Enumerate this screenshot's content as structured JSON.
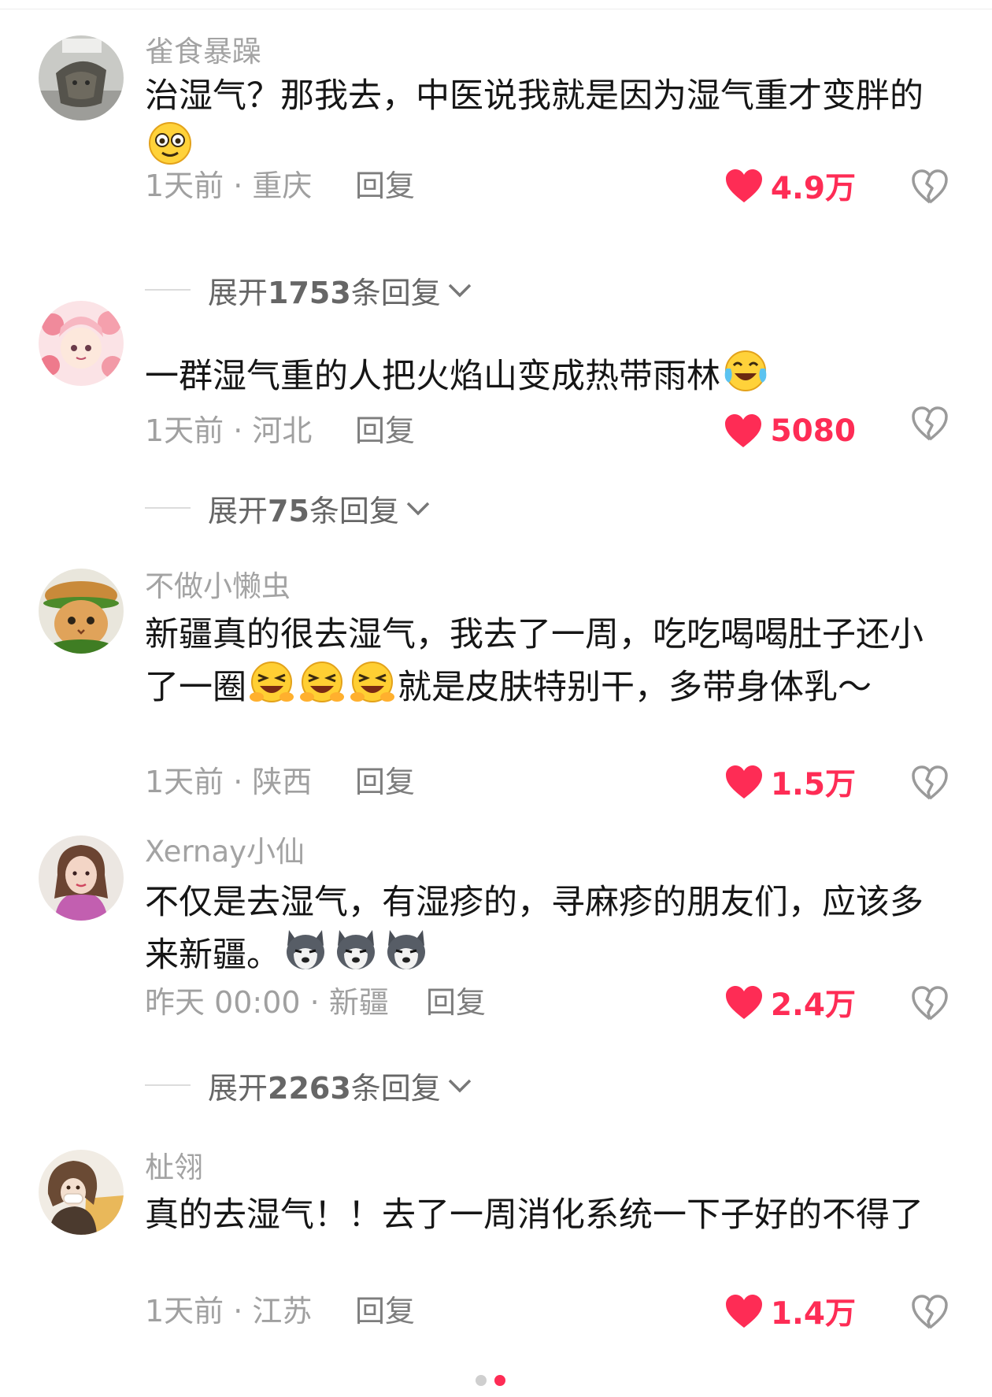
{
  "comments": [
    {
      "username": "雀食暴躁",
      "text": "治湿气？那我去，中医说我就是因为湿气重才变胖的",
      "emoji": "flushed-face",
      "time_location": "1天前 · 重庆",
      "reply_label": "回复",
      "likes": "4.9万",
      "expand_replies": {
        "prefix": "展开",
        "count": "1753",
        "suffix": "条回复"
      }
    },
    {
      "username": "",
      "text": "一群湿气重的人把火焰山变成热带雨林",
      "emoji": "tears-of-joy",
      "time_location": "1天前 · 河北",
      "reply_label": "回复",
      "likes": "5080",
      "expand_replies": {
        "prefix": "展开",
        "count": "75",
        "suffix": "条回复"
      }
    },
    {
      "username": "不做小懒虫",
      "text_before": "新疆真的很去湿气，我去了一周，吃吃喝喝肚子还小了一圈",
      "text_after": "就是皮肤特别干，多带身体乳～",
      "emoji": "laughing-squint",
      "emoji_count": 3,
      "time_location": "1天前 · 陕西",
      "reply_label": "回复",
      "likes": "1.5万"
    },
    {
      "username": "Xernay小仙",
      "text": "不仅是去湿气，有湿疹的，寻麻疹的朋友们，应该多来新疆。",
      "emoji": "husky-face",
      "emoji_count": 3,
      "time_location": "昨天 00:00 · 新疆",
      "reply_label": "回复",
      "likes": "2.4万",
      "expand_replies": {
        "prefix": "展开",
        "count": "2263",
        "suffix": "条回复"
      }
    },
    {
      "username": "杫翎",
      "text": "真的去湿气！！去了一周消化系统一下子好的不得了",
      "time_location": "1天前 · 江苏",
      "reply_label": "回复",
      "likes": "1.4万"
    }
  ],
  "colors": {
    "like": "#fe2c55",
    "meta": "#a0a0a0",
    "username": "#a3a3a3"
  },
  "pager": {
    "count": 2,
    "active": 2
  }
}
